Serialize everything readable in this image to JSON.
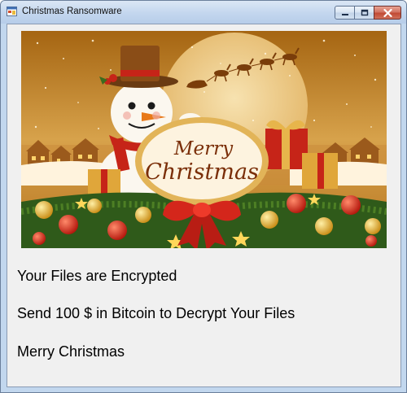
{
  "window": {
    "title": "Christmas Ransomware",
    "icon": "app-window-icon",
    "buttons": [
      "minimize-icon",
      "maximize-icon",
      "close-icon"
    ]
  },
  "banner": {
    "line1": "Merry",
    "line2": "Christmas"
  },
  "messages": {
    "encrypted": "Your Files are Encrypted",
    "ransom": "Send 100 $ in Bitcoin to Decrypt Your Files",
    "greeting": "Merry Christmas"
  }
}
